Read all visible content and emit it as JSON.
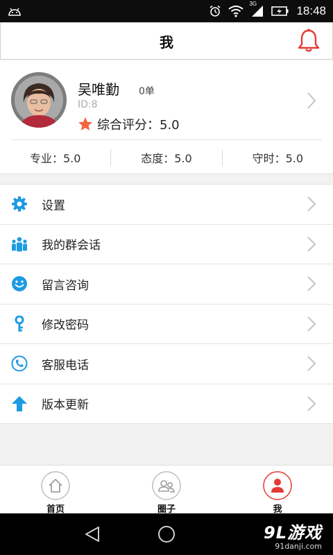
{
  "status_bar": {
    "network": "3G",
    "time": "18:48",
    "icons": [
      "android-icon",
      "alarm-icon",
      "wifi-icon",
      "signal-icon",
      "battery-icon"
    ]
  },
  "header": {
    "title": "我",
    "bell_color": "#e53935"
  },
  "profile": {
    "name": "吴唯勤",
    "orders": "0单",
    "id_text": "ID:8",
    "rating_label": "综合评分：5.0",
    "star_color": "#f0643f",
    "stats": [
      {
        "label": "专业：5.0"
      },
      {
        "label": "态度：5.0"
      },
      {
        "label": "守时：5.0"
      }
    ]
  },
  "menu": {
    "items": [
      {
        "label": "设置",
        "icon": "gear-icon"
      },
      {
        "label": "我的群会话",
        "icon": "group-icon"
      },
      {
        "label": "留言咨询",
        "icon": "smile-icon"
      },
      {
        "label": "修改密码",
        "icon": "key-icon"
      },
      {
        "label": "客服电话",
        "icon": "phone-icon"
      },
      {
        "label": "版本更新",
        "icon": "arrow-up-icon"
      }
    ],
    "icon_color": "#1d9be2"
  },
  "bottom_nav": {
    "items": [
      {
        "label": "首页",
        "icon": "home-icon",
        "active": false
      },
      {
        "label": "圈子",
        "icon": "circle-people-icon",
        "active": false
      },
      {
        "label": "我",
        "icon": "person-icon",
        "active": true
      }
    ],
    "active_color": "#e53935"
  },
  "watermark": {
    "main": "9L游戏",
    "sub": "91danji.com"
  }
}
